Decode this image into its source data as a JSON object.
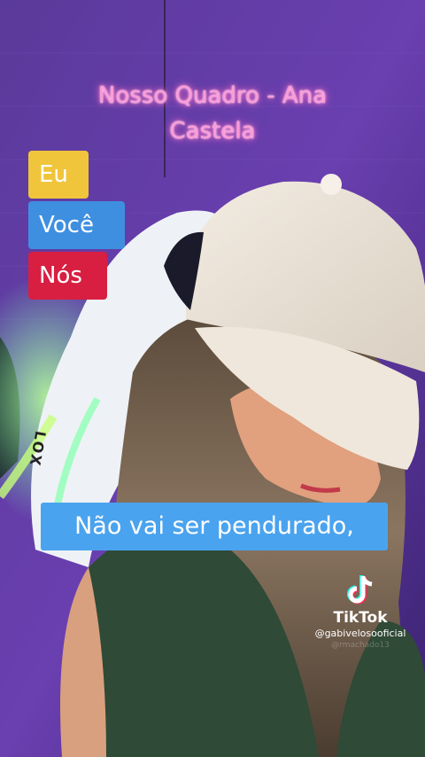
{
  "overlay": {
    "title_line1": "Nosso Quadro - Ana",
    "title_line2": "Castela",
    "legend": [
      {
        "label": "Eu",
        "color": "#f0c53c"
      },
      {
        "label": "Você",
        "color": "#3f8fe0"
      },
      {
        "label": "Nós",
        "color": "#d81f42"
      }
    ],
    "caption": "Não vai ser pendurado,"
  },
  "chair_print": "LOX",
  "watermark": {
    "brand": "TikTok",
    "username": "@gabivelosooficial",
    "faded_username": "@rmachado13"
  }
}
